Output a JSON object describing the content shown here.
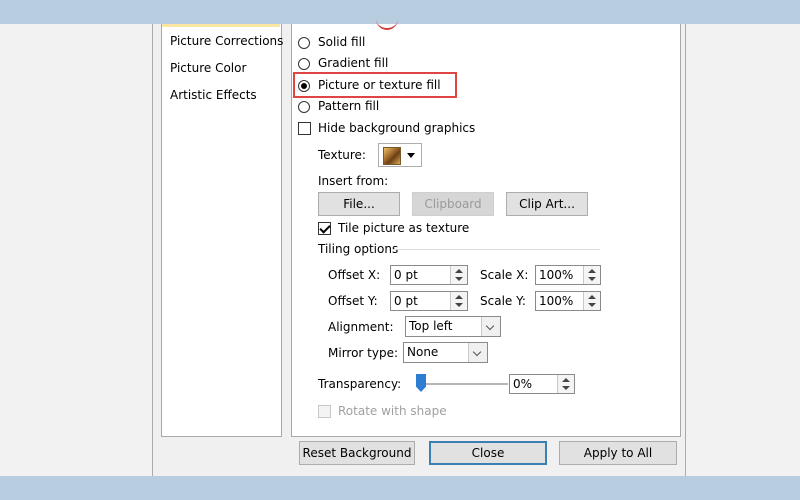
{
  "nav": {
    "items": [
      {
        "label": "Picture Corrections"
      },
      {
        "label": "Picture Color"
      },
      {
        "label": "Artistic Effects"
      }
    ]
  },
  "fill": {
    "options": [
      {
        "label": "Solid fill",
        "selected": false
      },
      {
        "label": "Gradient fill",
        "selected": false
      },
      {
        "label": "Picture or texture fill",
        "selected": true
      },
      {
        "label": "Pattern fill",
        "selected": false
      }
    ],
    "hide_background_label": "Hide background graphics",
    "hide_background_checked": false
  },
  "texture": {
    "label": "Texture:"
  },
  "insert": {
    "label": "Insert from:",
    "file_button": "File...",
    "clipboard_button": "Clipboard",
    "clipart_button": "Clip Art..."
  },
  "tile": {
    "label": "Tile picture as texture",
    "checked": true,
    "options_title": "Tiling options",
    "offset_x_label": "Offset X:",
    "offset_x_value": "0 pt",
    "offset_y_label": "Offset Y:",
    "offset_y_value": "0 pt",
    "scale_x_label": "Scale X:",
    "scale_x_value": "100%",
    "scale_y_label": "Scale Y:",
    "scale_y_value": "100%",
    "alignment_label": "Alignment:",
    "alignment_value": "Top left",
    "mirror_label": "Mirror type:",
    "mirror_value": "None"
  },
  "transparency": {
    "label": "Transparency:",
    "value": "0%",
    "level": 0
  },
  "rotate": {
    "label": "Rotate with shape",
    "checked": false,
    "enabled": false
  },
  "footer": {
    "reset_button": "Reset Background",
    "close_button": "Close",
    "apply_all_button": "Apply to All"
  },
  "colors": {
    "banner": "#b9cde0",
    "highlight": "#e04545",
    "default_button_border": "#3c7fb1",
    "slider_thumb": "#2d7dd2"
  }
}
